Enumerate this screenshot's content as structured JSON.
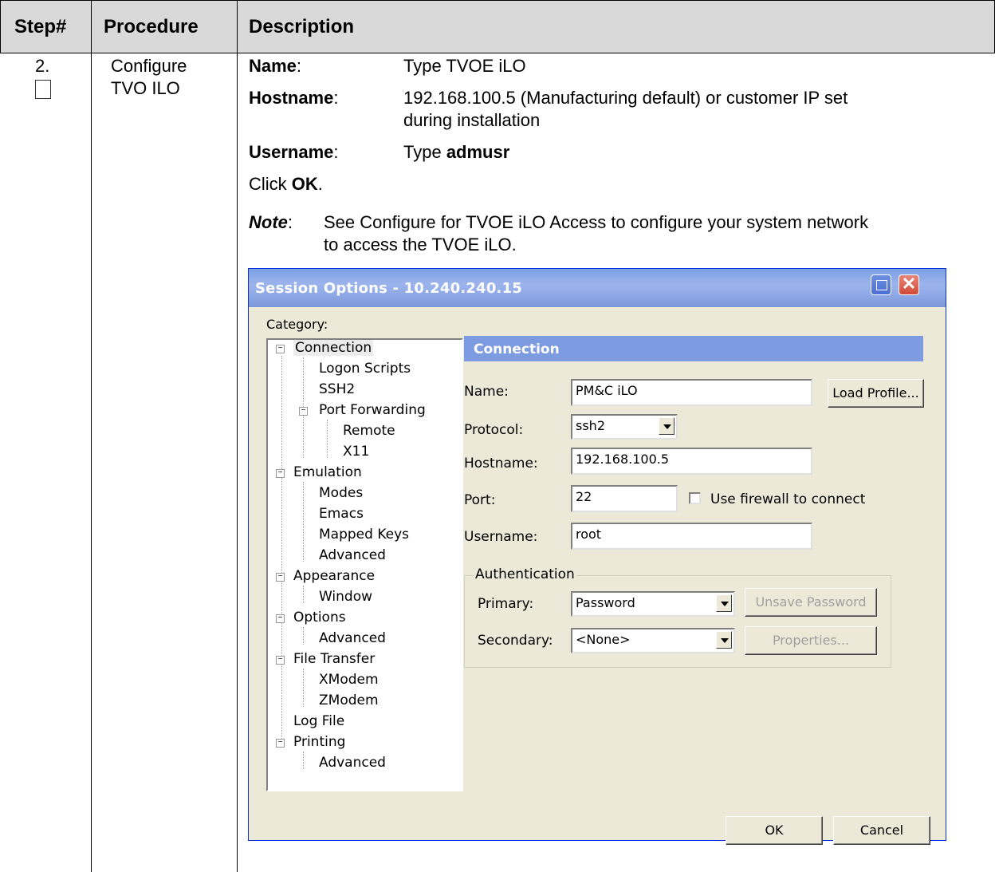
{
  "table": {
    "headers": [
      "Step#",
      "Procedure",
      "Description"
    ],
    "step": "2.",
    "procedure_line1": "Configure",
    "procedure_line2": "TVO ILO"
  },
  "description": {
    "name_label": "Name",
    "name_value": "Type TVOE iLO",
    "hostname_label": "Hostname",
    "hostname_value_line1": "192.168.100.5 (Manufacturing default) or customer IP set",
    "hostname_value_line2": "during installation",
    "username_label": "Username",
    "username_prefix": "Type ",
    "username_value": "admusr",
    "click_prefix": "Click ",
    "click_ok": "OK",
    "click_suffix": ".",
    "note_label": "Note",
    "note_line1": "See Configure for TVOE iLO Access to configure your system network",
    "note_line2": "to access the TVOE iLO."
  },
  "dialog": {
    "title": "Session Options - 10.240.240.15",
    "category_label": "Category:",
    "tree": [
      "Connection",
      "Logon Scripts",
      "SSH2",
      "Port Forwarding",
      "Remote",
      "X11",
      "Emulation",
      "Modes",
      "Emacs",
      "Mapped Keys",
      "Advanced",
      "Appearance",
      "Window",
      "Options",
      "Advanced",
      "File Transfer",
      "XModem",
      "ZModem",
      "Log File",
      "Printing",
      "Advanced"
    ],
    "panel_title": "Connection",
    "name_label": "Name:",
    "name_value": "PM&C iLO",
    "load_profile": "Load Profile...",
    "protocol_label": "Protocol:",
    "protocol_value": "ssh2",
    "hostname_label": "Hostname:",
    "hostname_value": "192.168.100.5",
    "port_label": "Port:",
    "port_value": "22",
    "firewall_label": "Use firewall to connect",
    "username_label": "Username:",
    "username_value": "root",
    "auth_label": "Authentication",
    "primary_label": "Primary:",
    "primary_value": "Password",
    "unsave_password": "Unsave Password",
    "secondary_label": "Secondary:",
    "secondary_value": "<None>",
    "properties": "Properties...",
    "ok": "OK",
    "cancel": "Cancel"
  }
}
